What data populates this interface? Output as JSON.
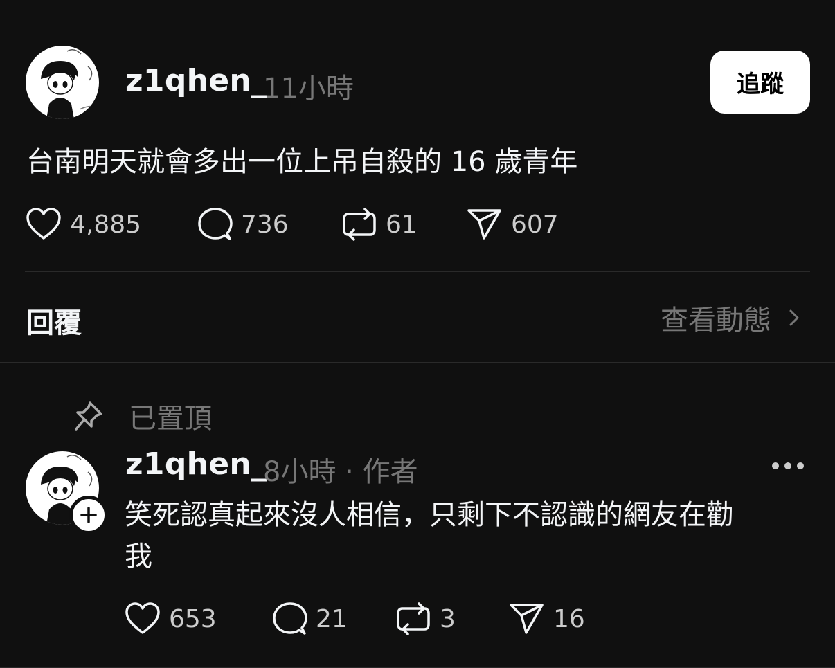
{
  "post": {
    "username": "z1qhen_",
    "time": "11小時",
    "follow_label": "追蹤",
    "text": "台南明天就會多出一位上吊自殺的 16 歲青年",
    "stats": {
      "likes": "4,885",
      "comments": "736",
      "reposts": "61",
      "shares": "607"
    }
  },
  "replies_section": {
    "title": "回覆",
    "view_activity": "查看動態"
  },
  "reply": {
    "pinned_label": "已置頂",
    "username": "z1qhen_",
    "meta": "8小時 · 作者",
    "text_line1": "笑死認真起來沒人相信，只剩下不認識的網友在勸",
    "text_line2": "我",
    "stats": {
      "likes": "653",
      "comments": "21",
      "reposts": "3",
      "shares": "16"
    }
  },
  "icons": [
    "heart-icon",
    "comment-icon",
    "repost-icon",
    "share-icon",
    "chevron-right-icon",
    "pin-icon",
    "plus-icon",
    "more-icon"
  ],
  "colors": {
    "background": "#101010",
    "text": "#f3f5f7",
    "muted": "#777777",
    "button": "#ffffff"
  }
}
